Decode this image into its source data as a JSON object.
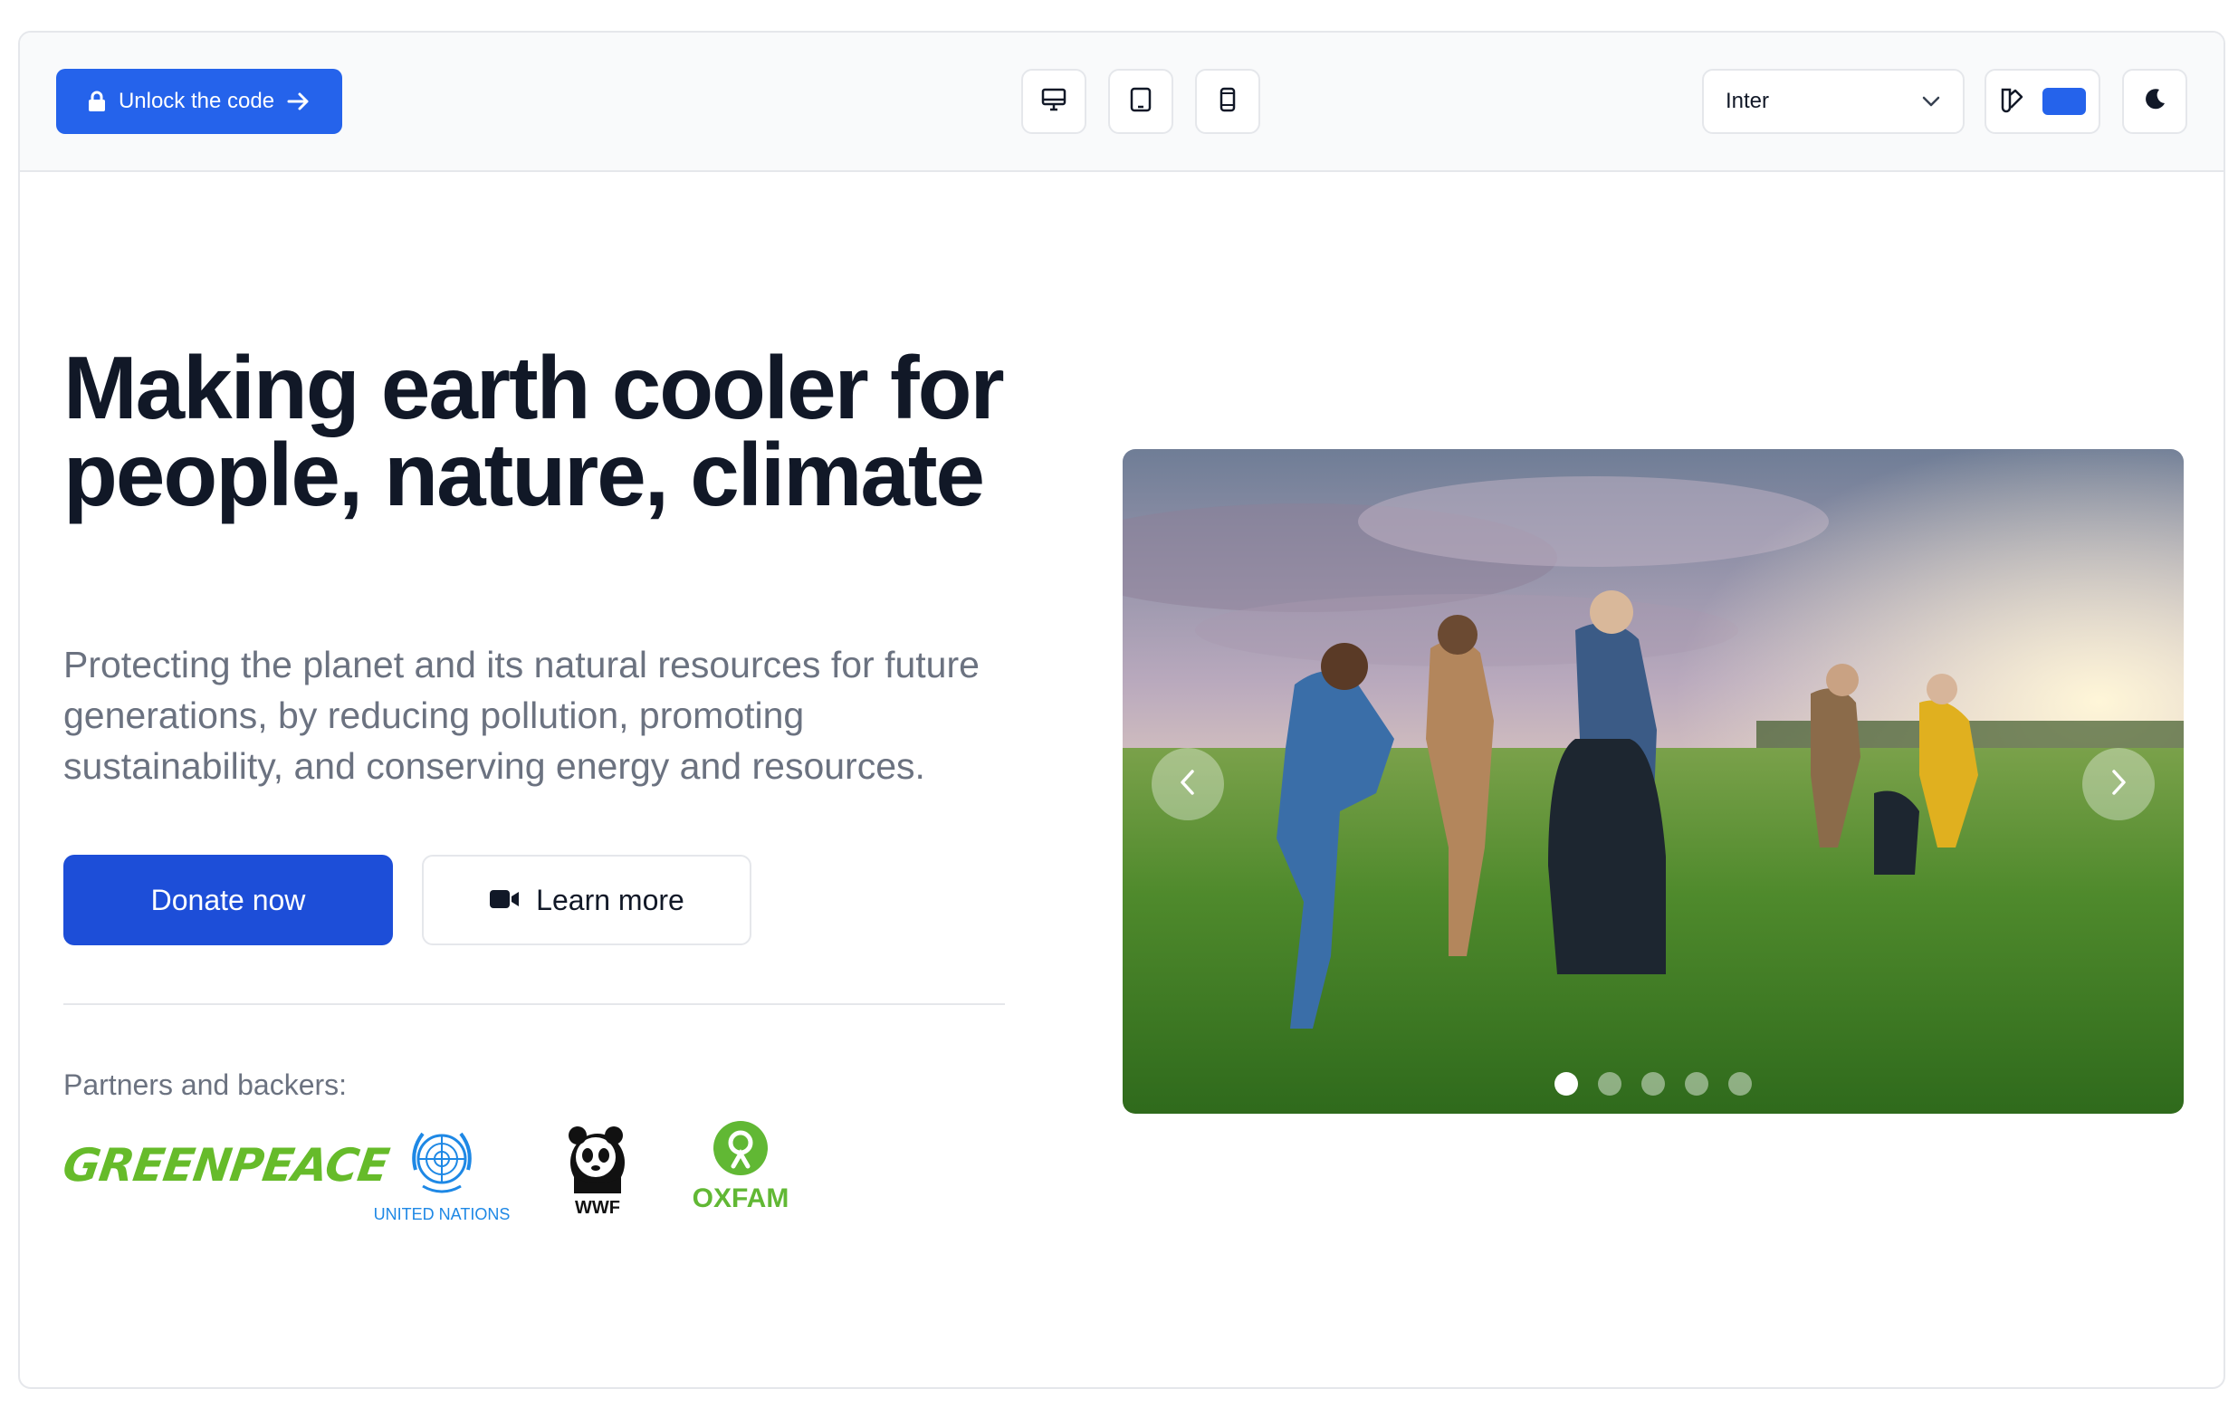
{
  "toolbar": {
    "unlock_label": "Unlock the code",
    "font_select": {
      "selected": "Inter"
    },
    "theme_color": "#2563eb"
  },
  "hero": {
    "headline": "Making earth cooler for people, nature, climate",
    "subtext": "Protecting the planet and its natural resources for future generations, by reducing pollution, promoting sustainability, and conserving energy and resources.",
    "donate_label": "Donate now",
    "learn_label": "Learn more"
  },
  "partners": {
    "label": "Partners and backers:",
    "logos": [
      {
        "name": "GREENPEACE",
        "color": "#66bb2a"
      },
      {
        "name": "UNITED NATIONS",
        "color": "#1e88e5"
      },
      {
        "name": "WWF",
        "color": "#111111"
      },
      {
        "name": "OXFAM",
        "color": "#61b834"
      }
    ]
  },
  "carousel": {
    "slide_count": 5,
    "active_index": 0
  },
  "colors": {
    "primary": "#1d4ed8",
    "accent": "#2563eb",
    "text": "#111827",
    "muted": "#6b7280",
    "border": "#e5e7eb"
  }
}
